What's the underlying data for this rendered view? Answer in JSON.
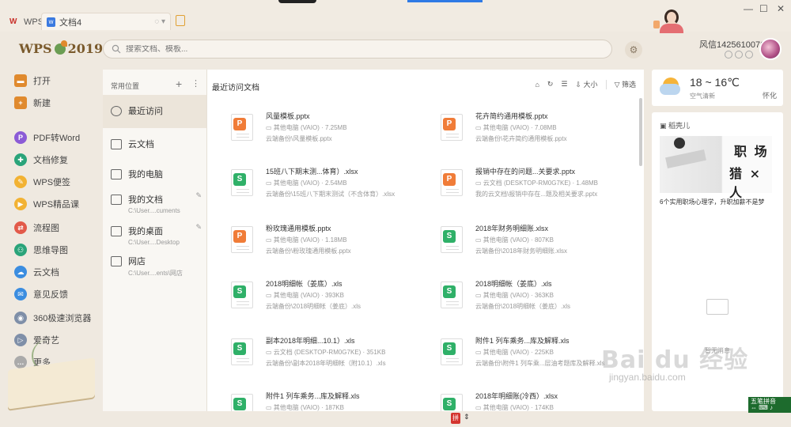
{
  "titlebar": {
    "app_tab": "WPS",
    "doc_tab": "文档4",
    "window_controls": [
      "—",
      "☐",
      "✕"
    ]
  },
  "header": {
    "brand": "WPS",
    "brand_year": "2019",
    "search_placeholder": "搜索文档、模板...",
    "username": "风信1425610076"
  },
  "sidebar": {
    "items": [
      {
        "label": "打开",
        "icon": "folder-icon",
        "color": "#e08a2e"
      },
      {
        "label": "新建",
        "icon": "plus-icon",
        "color": "#e08a2e"
      },
      {
        "label": "PDF转Word",
        "icon": "pdf-icon",
        "color": "#8b5bd6"
      },
      {
        "label": "文档修复",
        "icon": "repair-icon",
        "color": "#2aa47a"
      },
      {
        "label": "WPS便签",
        "icon": "note-icon",
        "color": "#f2b233"
      },
      {
        "label": "WPS精品课",
        "icon": "course-icon",
        "color": "#f2b233"
      },
      {
        "label": "流程图",
        "icon": "flowchart-icon",
        "color": "#e25a4a"
      },
      {
        "label": "思维导图",
        "icon": "mindmap-icon",
        "color": "#2aa47a"
      },
      {
        "label": "云文档",
        "icon": "cloud-icon",
        "color": "#3b8de0"
      },
      {
        "label": "意见反馈",
        "icon": "feedback-icon",
        "color": "#3b8de0"
      },
      {
        "label": "360极速浏览器",
        "icon": "browser-icon",
        "color": "#7f8fa8"
      },
      {
        "label": "爱奇艺",
        "icon": "video-icon",
        "color": "#7f8fa8"
      },
      {
        "label": "更多",
        "icon": "more-icon",
        "color": "#aaaaaa"
      }
    ]
  },
  "locations": {
    "header": "常用位置",
    "items": [
      {
        "title": "最近访问",
        "sub": ""
      },
      {
        "title": "云文档",
        "sub": ""
      },
      {
        "title": "我的电脑",
        "sub": ""
      },
      {
        "title": "我的文档",
        "sub": "C:\\User....cuments"
      },
      {
        "title": "我的桌面",
        "sub": "C:\\User....Desktop"
      },
      {
        "title": "网店",
        "sub": "C:\\User....ents\\网店"
      }
    ]
  },
  "main": {
    "title": "最近访问文档",
    "tools": {
      "size": "大小",
      "filter": "筛选"
    },
    "files": [
      {
        "name": "风量模板.pptx",
        "type": "P",
        "meta": "其他电脑 (VAIO)  · 7.25MB",
        "path": "云端备份\\风量模板.pptx"
      },
      {
        "name": "花卉简约通用模板.pptx",
        "type": "P",
        "meta": "其他电脑 (VAIO)  · 7.08MB",
        "path": "云端备份\\花卉简约通用模板.pptx"
      },
      {
        "name": "15班八下期末测...体育）.xlsx",
        "type": "S",
        "meta": "其他电脑 (VAIO)  · 2.54MB",
        "path": "云端备份\\15班八下期末测试（不含体育）.xlsx"
      },
      {
        "name": "报销中存在的问题...关要求.pptx",
        "type": "P",
        "meta": "云文档 (DESKTOP-RM0G7KE)  · 1.48MB",
        "path": "我的云文档\\报销中存在...题及相关要求.pptx"
      },
      {
        "name": "粉玫瑰通用模板.pptx",
        "type": "P",
        "meta": "其他电脑 (VAIO)  · 1.18MB",
        "path": "云端备份\\粉玫瑰通用模板.pptx"
      },
      {
        "name": "2018年财务明细账.xlsx",
        "type": "S",
        "meta": "其他电脑 (VAIO)  · 807KB",
        "path": "云端备份\\2018年财务明细账.xlsx"
      },
      {
        "name": "2018明细帐（姜底）.xls",
        "type": "S",
        "meta": "其他电脑 (VAIO)  · 393KB",
        "path": "云端备份\\2018明细帐（姜底）.xls"
      },
      {
        "name": "2018明细帐（姜底）.xls",
        "type": "S",
        "meta": "其他电脑 (VAIO)  · 363KB",
        "path": "云端备份\\2018明细帐（姜底）.xls"
      },
      {
        "name": "副本2018年明细...10.1）.xls",
        "type": "S",
        "meta": "云文档 (DESKTOP-RM0G7KE)  · 351KB",
        "path": "云端备份\\副本2018年明细帐（附10.1）.xls"
      },
      {
        "name": "附件1 列车乘务...库及解释.xls",
        "type": "S",
        "meta": "其他电脑 (VAIO)  · 225KB",
        "path": "云端备份\\附件1 列车乘...层油考题库及解释.xls"
      },
      {
        "name": "附件1 列车乘务...库及解释.xls",
        "type": "S",
        "meta": "其他电脑 (VAIO)  · 187KB",
        "path": ""
      },
      {
        "name": "2018年明细账(冷西）.xlsx",
        "type": "S",
        "meta": "其他电脑 (VAIO)  · 174KB",
        "path": ""
      }
    ]
  },
  "weather": {
    "temp": "18 ~ 16℃",
    "desc": "空气清新",
    "city": "怀化"
  },
  "news": {
    "header": "稻壳儿",
    "image_text_1": "职 场",
    "image_text_2": "猎 × 人",
    "caption": "6个实用职场心理学，升职加薪不是梦",
    "empty": "暂无消息"
  },
  "watermark": {
    "text": "Bai du 经验",
    "url": "jingyan.baidu.com"
  },
  "ime": {
    "line1": "五笔拼音",
    "line2": "⇔ ⌨ ♪"
  },
  "colors": {
    "ppt": "#f07c38",
    "sheet": "#2fb068",
    "accent": "#e08a2e"
  }
}
